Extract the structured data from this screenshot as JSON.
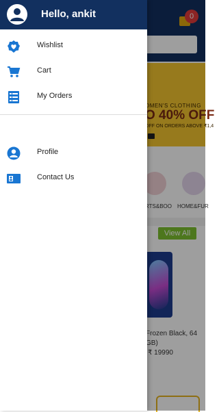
{
  "background": {
    "cart_count": "0",
    "banner": {
      "category": "OMEN'S CLOTHING",
      "offer": "O 40% OFF",
      "sub": "OFF ON ORDERS ABOVE ₹1,4"
    },
    "categories": [
      "RTS&BOO",
      "HOME&FUR"
    ],
    "view_all_label": "View All",
    "product": {
      "name": "Frozen Black, 64 GB)",
      "price": "₹ 19990"
    }
  },
  "drawer": {
    "greeting": "Hello, ankit",
    "menu": [
      {
        "label": "Wishlist",
        "icon": "heart-badge-icon"
      },
      {
        "label": "Cart",
        "icon": "shopping-cart-icon"
      },
      {
        "label": "My Orders",
        "icon": "orders-list-icon"
      },
      {
        "label": "Profile",
        "icon": "person-icon"
      },
      {
        "label": "Contact Us",
        "icon": "contact-card-icon"
      }
    ]
  },
  "colors": {
    "header": "#12305f",
    "icon": "#1976d2",
    "banner": "#f4c62f",
    "accent_green": "#7dc12f"
  }
}
